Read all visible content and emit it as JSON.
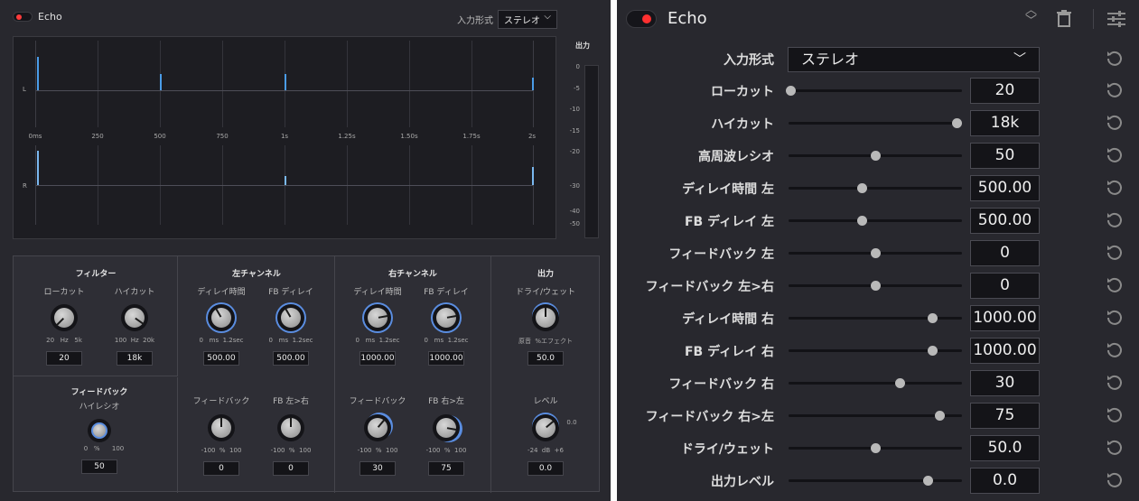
{
  "left": {
    "title": "Echo",
    "input_mode_label": "入力形式",
    "input_mode_value": "ステレオ",
    "output_label": "出力",
    "channel_labels": {
      "L": "L",
      "R": "R"
    },
    "time_ticks": [
      "0ms",
      "250",
      "500",
      "750",
      "1s",
      "1.25s",
      "1.50s",
      "1.75s",
      "2s"
    ],
    "db_ticks": [
      "0",
      "-5",
      "-10",
      "-15",
      "-20",
      "-30",
      "-40",
      "-50"
    ],
    "sections": {
      "filter": {
        "title": "フィルター",
        "lowcut": {
          "label": "ローカット",
          "range": [
            "20",
            "Hz",
            "5k"
          ],
          "value": "20"
        },
        "highcut": {
          "label": "ハイカット",
          "range": [
            "100",
            "Hz",
            "20k"
          ],
          "value": "18k"
        }
      },
      "feedback": {
        "title": "フィードバック",
        "highratio": {
          "label": "ハイレシオ",
          "range": [
            "0",
            "%",
            "100"
          ],
          "value": "50"
        }
      },
      "left_ch": {
        "title": "左チャンネル",
        "delay": {
          "label": "ディレイ時間",
          "range": [
            "0",
            "ms",
            "1.2sec"
          ],
          "value": "500.00"
        },
        "fb_delay": {
          "label": "FB ディレイ",
          "range": [
            "0",
            "ms",
            "1.2sec"
          ],
          "value": "500.00"
        },
        "feedback": {
          "label": "フィードバック",
          "range": [
            "-100",
            "%",
            "100"
          ],
          "value": "0"
        },
        "fb_cross": {
          "label": "FB 左>右",
          "range": [
            "-100",
            "%",
            "100"
          ],
          "value": "0"
        }
      },
      "right_ch": {
        "title": "右チャンネル",
        "delay": {
          "label": "ディレイ時間",
          "range": [
            "0",
            "ms",
            "1.2sec"
          ],
          "value": "1000.00"
        },
        "fb_delay": {
          "label": "FB ディレイ",
          "range": [
            "0",
            "ms",
            "1.2sec"
          ],
          "value": "1000.00"
        },
        "feedback": {
          "label": "フィードバック",
          "range": [
            "-100",
            "%",
            "100"
          ],
          "value": "30"
        },
        "fb_cross": {
          "label": "FB 右>左",
          "range": [
            "-100",
            "%",
            "100"
          ],
          "value": "75"
        }
      },
      "output": {
        "title": "出力",
        "drywet": {
          "label": "ドライ/ウェット",
          "range": [
            "原音",
            "%エフェクト"
          ],
          "value": "50.0"
        },
        "level": {
          "label": "レベル",
          "range": [
            "-24",
            "dB",
            "+6"
          ],
          "extra": "0.0",
          "value": "0.0"
        }
      }
    }
  },
  "right": {
    "title": "Echo",
    "icons": [
      "chevron-updown-icon",
      "trash-icon",
      "sliders-icon"
    ],
    "input_mode": {
      "label": "入力形式",
      "value": "ステレオ"
    },
    "params": [
      {
        "label": "ローカット",
        "value": "20",
        "level": 0.01
      },
      {
        "label": "ハイカット",
        "value": "18k",
        "level": 0.97
      },
      {
        "label": "高周波レシオ",
        "value": "50",
        "level": 0.5
      },
      {
        "label": "ディレイ時間 左",
        "value": "500.00",
        "level": 0.42
      },
      {
        "label": "FB ディレイ 左",
        "value": "500.00",
        "level": 0.42
      },
      {
        "label": "フィードバック 左",
        "value": "0",
        "level": 0.5
      },
      {
        "label": "フィードバック 左>右",
        "value": "0",
        "level": 0.5
      },
      {
        "label": "ディレイ時間 右",
        "value": "1000.00",
        "level": 0.83
      },
      {
        "label": "FB ディレイ 右",
        "value": "1000.00",
        "level": 0.83
      },
      {
        "label": "フィードバック 右",
        "value": "30",
        "level": 0.64
      },
      {
        "label": "フィードバック 右>左",
        "value": "75",
        "level": 0.87
      },
      {
        "label": "ドライ/ウェット",
        "value": "50.0",
        "level": 0.5
      },
      {
        "label": "出力レベル",
        "value": "0.0",
        "level": 0.8
      }
    ]
  }
}
